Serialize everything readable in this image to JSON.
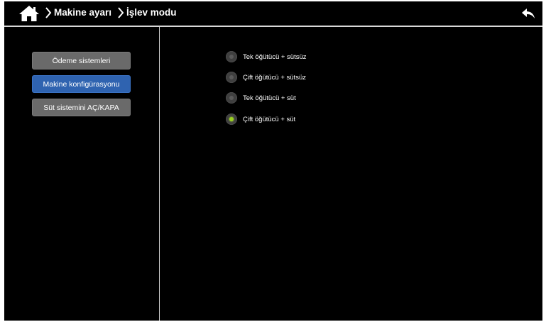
{
  "header": {
    "breadcrumb": [
      "Makine ayarı",
      "İşlev modu"
    ],
    "home_icon": "home-icon",
    "back_icon": "back-arrow-icon"
  },
  "sidebar": {
    "items": [
      {
        "label": "Ödeme sistemleri",
        "state": "normal"
      },
      {
        "label": "Makine konfigürasyonu",
        "state": "selected"
      },
      {
        "label": "Süt sistemini AÇ/KAPA",
        "state": "normal"
      }
    ]
  },
  "options": {
    "items": [
      {
        "label": "Tek öğütücü + sütsüz",
        "selected": false
      },
      {
        "label": "Çift öğütücü + sütsüz",
        "selected": false
      },
      {
        "label": "Tek öğütücü + süt",
        "selected": false
      },
      {
        "label": "Çift öğütücü + süt",
        "selected": true
      }
    ]
  },
  "colors": {
    "background": "#000000",
    "selected_button": "#2f63b0",
    "normal_button": "#6a6a6a",
    "radio_active": "#9ad21f"
  }
}
